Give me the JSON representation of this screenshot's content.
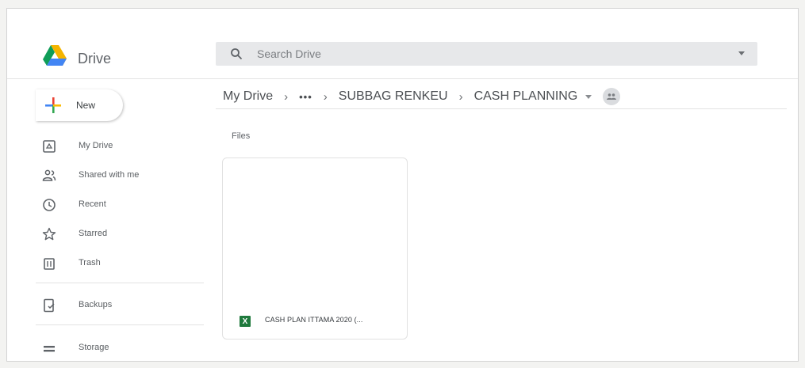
{
  "app": {
    "name": "Drive"
  },
  "search": {
    "placeholder": "Search Drive"
  },
  "new_button": {
    "label": "New"
  },
  "sidebar": {
    "items": [
      {
        "label": "My Drive",
        "icon": "my-drive-icon"
      },
      {
        "label": "Shared with me",
        "icon": "shared-people-icon"
      },
      {
        "label": "Recent",
        "icon": "clock-icon"
      },
      {
        "label": "Starred",
        "icon": "star-icon"
      },
      {
        "label": "Trash",
        "icon": "trash-icon"
      }
    ],
    "secondary": [
      {
        "label": "Backups",
        "icon": "backup-device-icon"
      },
      {
        "label": "Storage",
        "icon": "storage-icon"
      }
    ]
  },
  "breadcrumb": {
    "root": "My Drive",
    "more": "•••",
    "parent": "SUBBAG RENKEU",
    "current": "CASH PLANNING"
  },
  "main": {
    "section_label": "Files"
  },
  "files": [
    {
      "name": "CASH PLAN ITTAMA 2020 (...",
      "type_badge": "X"
    }
  ],
  "colors": {
    "drive_yellow": "#f4b400",
    "drive_green": "#0f9d58",
    "drive_blue": "#4285f4",
    "excel_green": "#1f7a3d"
  }
}
